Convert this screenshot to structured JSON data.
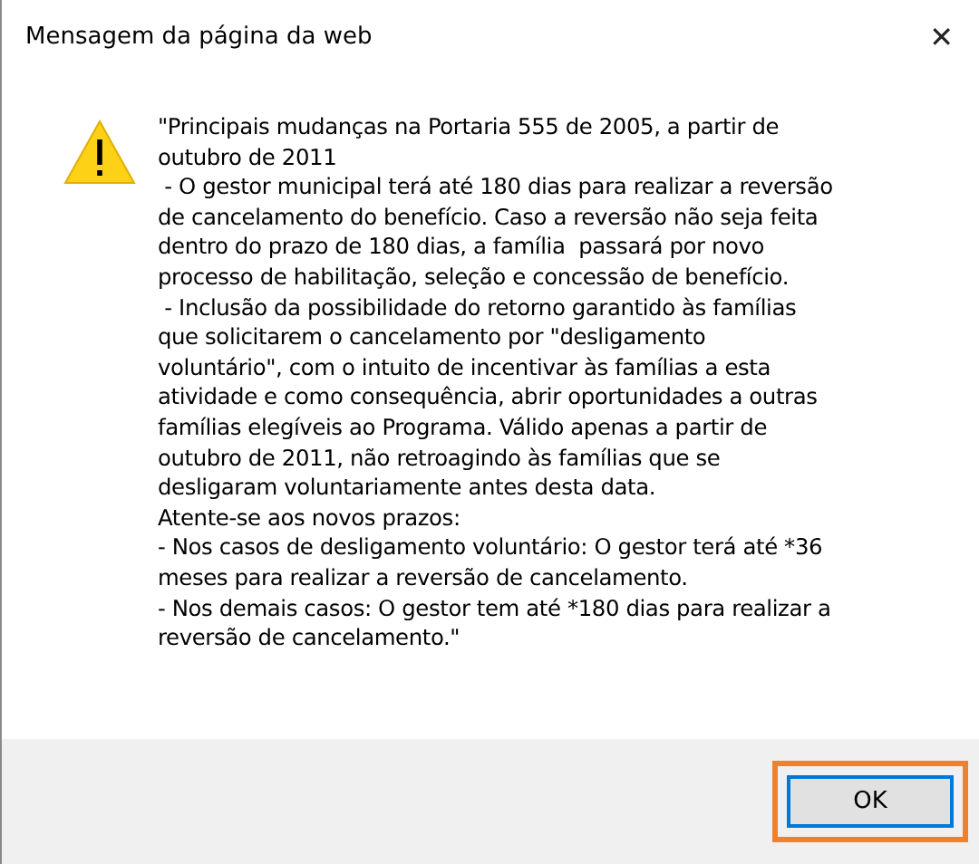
{
  "window": {
    "title": "Mensagem da página da web",
    "close": "✕"
  },
  "message": {
    "kind": "warning",
    "lines": [
      "\"Principais mudanças na Portaria 555 de 2005, a partir de",
      "outubro de 2011",
      " - O gestor municipal terá até 180 dias para realizar a reversão",
      "de cancelamento do benefício. Caso a reversão não seja feita",
      "dentro do prazo de 180 dias, a família  passará por novo",
      "processo de habilitação, seleção e concessão de benefício.",
      " - Inclusão da possibilidade do retorno garantido às famílias",
      "que solicitarem o cancelamento por \"desligamento",
      "voluntário\", com o intuito de incentivar às famílias a esta",
      "atividade e como consequência, abrir oportunidades a outras",
      "famílias elegíveis ao Programa. Válido apenas a partir de",
      "outubro de 2011, não retroagindo às famílias que se",
      "desligaram voluntariamente antes desta data.",
      "Atente-se aos novos prazos:",
      "- Nos casos de desligamento voluntário: O gestor terá até *36",
      "meses para realizar a reversão de cancelamento.",
      "- Nos demais casos: O gestor tem até *180 dias para realizar a",
      "reversão de cancelamento.\""
    ]
  },
  "buttons": [
    {
      "label": "OK",
      "highlighted": true
    }
  ]
}
